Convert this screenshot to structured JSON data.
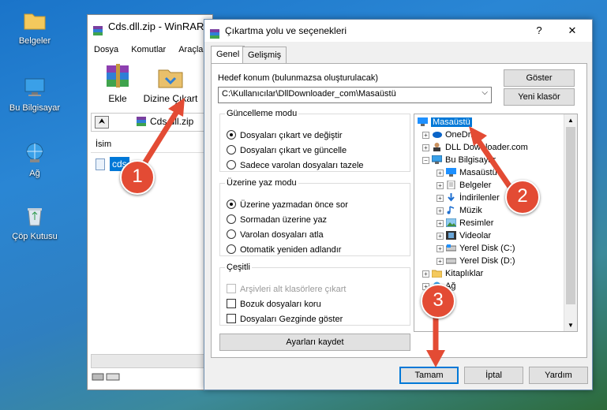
{
  "desktop": {
    "icons": [
      {
        "label": "Belgeler"
      },
      {
        "label": "Bu Bilgisayar"
      },
      {
        "label": "Ağ"
      },
      {
        "label": "Çöp Kutusu"
      }
    ]
  },
  "winrar": {
    "title": "Cds.dll.zip - WinRAR",
    "menu": [
      "Dosya",
      "Komutlar",
      "Araçlar"
    ],
    "toolbar": {
      "add_label": "Ekle",
      "extract_label": "Dizine Çıkart"
    },
    "address": "Cds.dll.zip",
    "column_header": "İsim",
    "file_row": "cds"
  },
  "dialog": {
    "title": "Çıkartma yolu ve seçenekleri",
    "help_glyph": "?",
    "close_glyph": "✕",
    "tabs": [
      "Genel",
      "Gelişmiş"
    ],
    "destination_label": "Hedef konum (bulunmazsa oluşturulacak)",
    "destination_value": "C:\\Kullanıcılar\\DllDownloader_com\\Masaüstü",
    "show_button": "Göster",
    "new_folder_button": "Yeni klasör",
    "update_mode": {
      "legend": "Güncelleme modu",
      "options": [
        "Dosyaları çıkart ve değiştir",
        "Dosyaları çıkart ve güncelle",
        "Sadece varolan dosyaları tazele"
      ],
      "selected": 0
    },
    "overwrite_mode": {
      "legend": "Üzerine yaz modu",
      "options": [
        "Üzerine yazmadan önce sor",
        "Sormadan üzerine yaz",
        "Varolan dosyaları atla",
        "Otomatik yeniden adlandır"
      ],
      "selected": 0
    },
    "misc": {
      "legend": "Çeşitli",
      "options": [
        "Arşivleri alt klasörlere çıkart",
        "Bozuk dosyaları koru",
        "Dosyaları Gezginde göster"
      ]
    },
    "save_settings_button": "Ayarları kaydet",
    "tree": [
      {
        "label": "Masaüstü",
        "selected": true
      },
      {
        "label": "OneDrive"
      },
      {
        "label": "DLL Downloader.com"
      },
      {
        "label": "Bu Bilgisayar"
      },
      {
        "label": "Masaüstü"
      },
      {
        "label": "Belgeler"
      },
      {
        "label": "İndirilenler"
      },
      {
        "label": "Müzik"
      },
      {
        "label": "Resimler"
      },
      {
        "label": "Videolar"
      },
      {
        "label": "Yerel Disk (C:)"
      },
      {
        "label": "Yerel Disk (D:)"
      },
      {
        "label": "Kitaplıklar"
      },
      {
        "label": "Ağ"
      }
    ],
    "ok_button": "Tamam",
    "cancel_button": "İptal",
    "help_button": "Yardım"
  },
  "annotations": {
    "step1": "1",
    "step2": "2",
    "step3": "3"
  },
  "colors": {
    "accent": "#0078d7",
    "arrow": "#e34b34",
    "selection": "#0078d7"
  }
}
